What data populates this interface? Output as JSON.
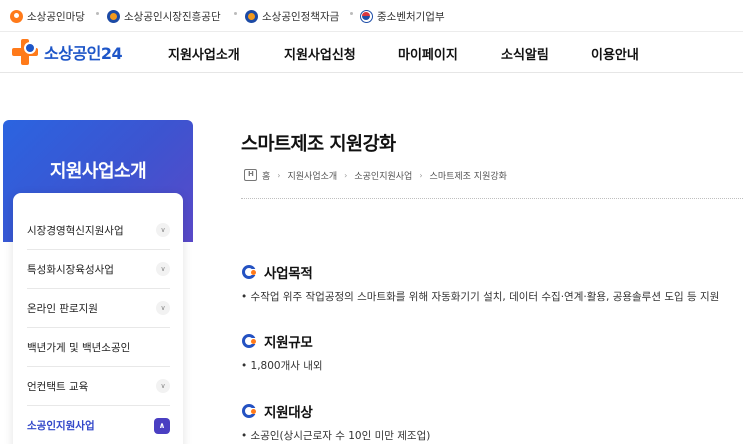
{
  "util_bar": {
    "items": [
      {
        "label": "소상공인마당",
        "icon": "madang-logo-icon"
      },
      {
        "label": "소상공인시장진흥공단",
        "icon": "semas-logo-icon"
      },
      {
        "label": "소상공인정책자금",
        "icon": "semas-logo-icon"
      },
      {
        "label": "중소벤처기업부",
        "icon": "gov-emblem-icon"
      }
    ]
  },
  "header": {
    "logo_text": "소상공인24",
    "nav": [
      "지원사업소개",
      "지원사업신청",
      "마이페이지",
      "소식알림",
      "이용안내"
    ]
  },
  "sidebar": {
    "title": "지원사업소개",
    "items": [
      {
        "label": "시장경영혁신지원사업",
        "has_chevron": true
      },
      {
        "label": "특성화시장육성사업",
        "has_chevron": true
      },
      {
        "label": "온라인 판로지원",
        "has_chevron": true
      },
      {
        "label": "백년가게 및 백년소공인",
        "has_chevron": false
      },
      {
        "label": "언컨택트 교육",
        "has_chevron": true
      },
      {
        "label": "소공인지원사업",
        "has_chevron": true,
        "active": true
      }
    ]
  },
  "main": {
    "title": "스마트제조 지원강화",
    "breadcrumb": [
      "홈",
      "지원사업소개",
      "소공인지원사업",
      "스마트제조 지원강화"
    ],
    "sections": [
      {
        "title": "사업목적",
        "body": "• 수작업 위주 작업공정의 스마트화를 위해 자동화기기 설치, 데이터 수집·연계·활용, 공용솔루션 도입 등 지원"
      },
      {
        "title": "지원규모",
        "body": "• 1,800개사 내외"
      },
      {
        "title": "지원대상",
        "body": "• 소공인(상시근로자 수 10인 미만 제조업)"
      }
    ]
  },
  "colors": {
    "brand_blue": "#1e56c8",
    "brand_orange": "#ff7a1a",
    "sidebar_gradient_start": "#2b64e0",
    "sidebar_gradient_end": "#5a49c8",
    "active_item": "#3247c9"
  }
}
